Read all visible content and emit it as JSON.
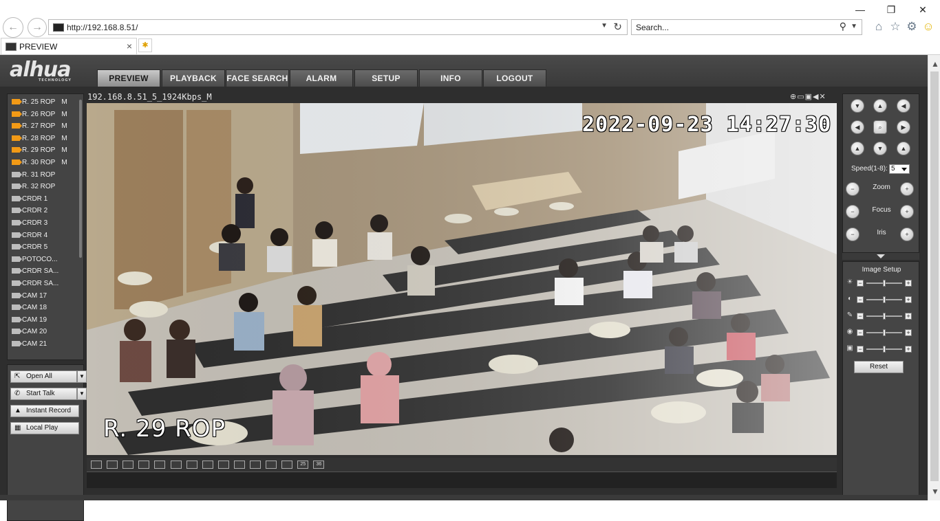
{
  "browser": {
    "url": "http://192.168.8.51/",
    "search_placeholder": "Search...",
    "tab_title": "PREVIEW",
    "tab_close": "×"
  },
  "app": {
    "logo": "alhua",
    "logo_sub": "TECHNOLOGY",
    "nav": [
      "PREVIEW",
      "PLAYBACK",
      "FACE SEARCH",
      "ALARM",
      "SETUP",
      "INFO",
      "LOGOUT"
    ],
    "active_nav": "PREVIEW"
  },
  "channels": [
    {
      "name": "R. 25 ROP",
      "stream": "M",
      "active": true
    },
    {
      "name": "R. 26 ROP",
      "stream": "M",
      "active": true
    },
    {
      "name": "R. 27 ROP",
      "stream": "M",
      "active": true
    },
    {
      "name": "R. 28 ROP",
      "stream": "M",
      "active": true
    },
    {
      "name": "R. 29 ROP",
      "stream": "M",
      "active": true
    },
    {
      "name": "R. 30 ROP",
      "stream": "M",
      "active": true
    },
    {
      "name": "R. 31 ROP",
      "stream": "",
      "active": false
    },
    {
      "name": "R. 32 ROP",
      "stream": "",
      "active": false
    },
    {
      "name": "CRDR 1",
      "stream": "",
      "active": false
    },
    {
      "name": "CRDR 2",
      "stream": "",
      "active": false
    },
    {
      "name": "CRDR 3",
      "stream": "",
      "active": false
    },
    {
      "name": "CRDR 4",
      "stream": "",
      "active": false
    },
    {
      "name": "CRDR 5",
      "stream": "",
      "active": false
    },
    {
      "name": "POTOCO...",
      "stream": "",
      "active": false
    },
    {
      "name": "CRDR SA...",
      "stream": "",
      "active": false
    },
    {
      "name": "CRDR SA...",
      "stream": "",
      "active": false
    },
    {
      "name": "CAM 17",
      "stream": "",
      "active": false
    },
    {
      "name": "CAM 18",
      "stream": "",
      "active": false
    },
    {
      "name": "CAM 19",
      "stream": "",
      "active": false
    },
    {
      "name": "CAM 20",
      "stream": "",
      "active": false
    },
    {
      "name": "CAM 21",
      "stream": "",
      "active": false
    }
  ],
  "left_buttons": {
    "open_all": "Open All",
    "start_talk": "Start Talk",
    "instant_record": "Instant Record",
    "local_play": "Local Play"
  },
  "video": {
    "stream_title": "192.168.8.51_5_1924Kbps_M",
    "timestamp": "2022-09-23 14:27:30",
    "camera_name": "R. 29 ROP"
  },
  "layout_buttons": [
    "",
    "",
    "",
    "",
    "",
    "",
    "",
    "",
    "",
    "",
    "",
    "",
    "",
    "25",
    "36"
  ],
  "ptz": {
    "speed_label": "Speed(1-8):",
    "speed_value": "5",
    "zoom": "Zoom",
    "focus": "Focus",
    "iris": "Iris"
  },
  "image_setup": {
    "title": "Image Setup",
    "sliders": [
      {
        "name": "brightness",
        "value": 0.5
      },
      {
        "name": "contrast",
        "value": 0.5
      },
      {
        "name": "saturation",
        "value": 0.5
      },
      {
        "name": "sharpness",
        "value": 0.5
      },
      {
        "name": "gain",
        "value": 0.5
      }
    ],
    "reset": "Reset"
  }
}
